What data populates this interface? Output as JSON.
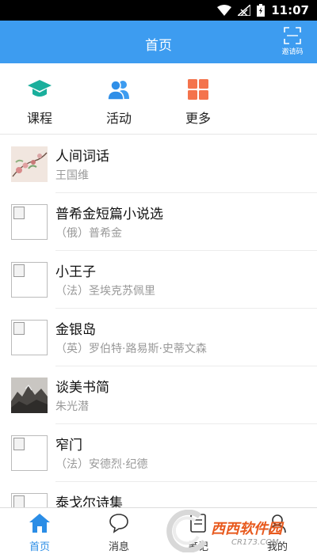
{
  "status_bar": {
    "time": "11:07"
  },
  "header": {
    "title": "首页",
    "invite_label": "邀请码"
  },
  "quick_nav": [
    {
      "label": "课程",
      "icon": "graduation-cap-icon",
      "color": "#1aaf9c"
    },
    {
      "label": "活动",
      "icon": "people-icon",
      "color": "#3d9cf0"
    },
    {
      "label": "更多",
      "icon": "grid-icon",
      "color": "#f4734c"
    }
  ],
  "books": [
    {
      "title": "人间词话",
      "author": "王国维",
      "cover": "image"
    },
    {
      "title": "普希金短篇小说选",
      "author": "（俄）普希金",
      "cover": "broken"
    },
    {
      "title": "小王子",
      "author": "（法）圣埃克苏佩里",
      "cover": "broken"
    },
    {
      "title": "金银岛",
      "author": "（英）罗伯特·路易斯·史蒂文森",
      "cover": "broken"
    },
    {
      "title": "谈美书简",
      "author": "朱光潜",
      "cover": "image"
    },
    {
      "title": "窄门",
      "author": "（法）安德烈·纪德",
      "cover": "broken"
    },
    {
      "title": "泰戈尔诗集",
      "author": "",
      "cover": "broken"
    }
  ],
  "tabs": [
    {
      "label": "首页",
      "icon": "home-icon",
      "active": true
    },
    {
      "label": "消息",
      "icon": "chat-bubble-icon",
      "active": false
    },
    {
      "label": "笔记",
      "icon": "note-icon",
      "active": false
    },
    {
      "label": "我的",
      "icon": "profile-icon",
      "active": false
    }
  ],
  "watermark": {
    "brand": "西西软件园",
    "url": "CR173.COM"
  },
  "colors": {
    "primary": "#3d9cf0",
    "tab_active": "#2b8de6"
  }
}
